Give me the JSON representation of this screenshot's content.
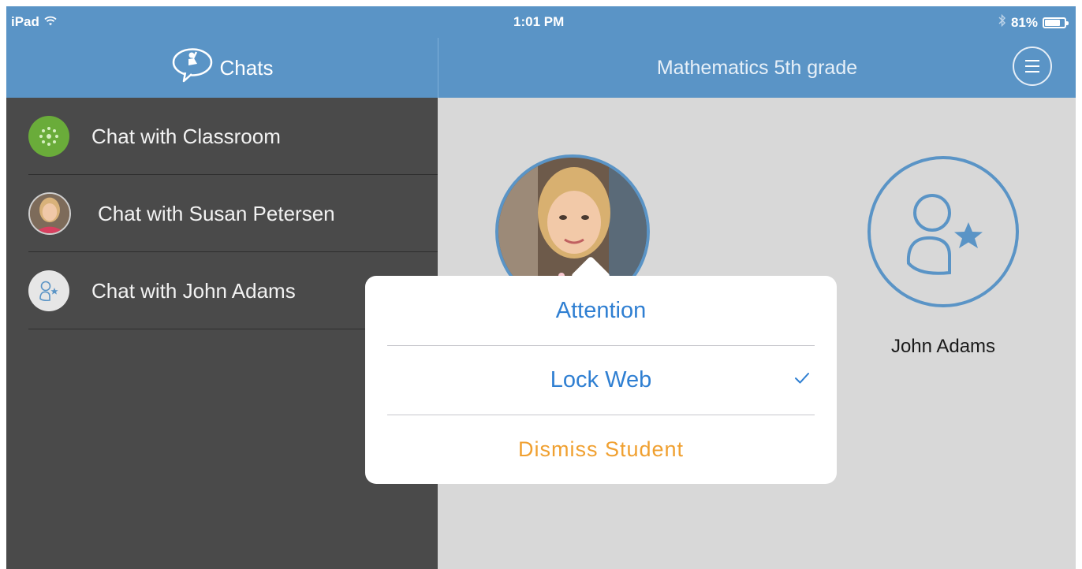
{
  "status_bar": {
    "carrier": "iPad",
    "time": "1:01 PM",
    "battery_text": "81%",
    "battery_level": 0.81
  },
  "sidebar": {
    "title": "Chats",
    "items": [
      {
        "label": "Chat with Classroom",
        "icon": "classroom-icon"
      },
      {
        "label": "Chat with Susan Petersen",
        "icon": "avatar-photo"
      },
      {
        "label": "Chat with John Adams",
        "icon": "user-star-icon"
      }
    ]
  },
  "header": {
    "title": "Mathematics 5th grade",
    "menu_icon": "menu-icon"
  },
  "students": [
    {
      "name": "",
      "avatar": "photo"
    },
    {
      "name": "John Adams",
      "avatar": "user-star-icon"
    }
  ],
  "popover": {
    "items": [
      {
        "label": "Attention",
        "checked": false
      },
      {
        "label": "Lock Web",
        "checked": true
      },
      {
        "label": "Dismiss Student",
        "checked": false
      }
    ]
  },
  "colors": {
    "header_bg": "#5a94c6",
    "sidebar_bg": "#4a4a4a",
    "main_bg": "#d8d8d8",
    "accent_blue": "#2f7fd2",
    "warning_orange": "#f0a030",
    "classroom_green": "#6aac3a"
  }
}
